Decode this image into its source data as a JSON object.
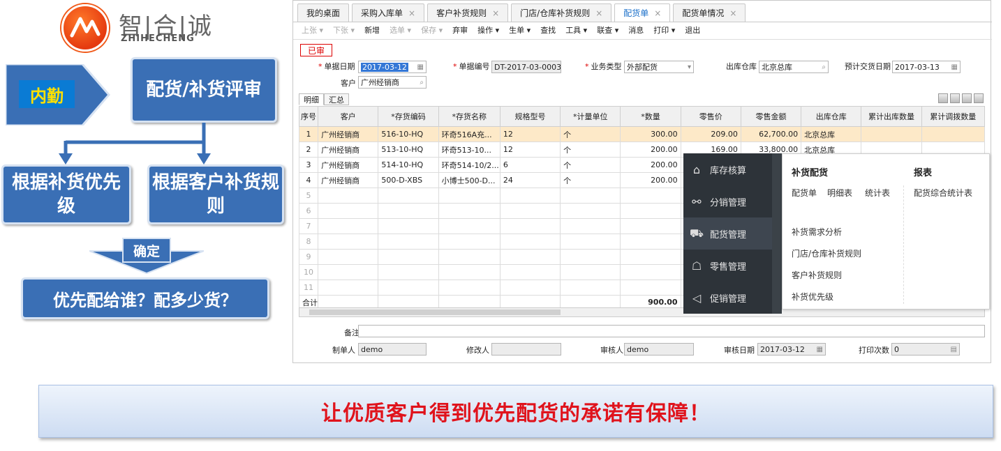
{
  "logo": {
    "name": "智|合|诚",
    "sub": "ZHIHECHENG"
  },
  "flow": {
    "inner": "内勤",
    "review": "配货/补货评审",
    "priority": "根据补货优先级",
    "rule": "根据客户补货规则",
    "confirm": "确定",
    "question": "优先配给谁？配多少货？"
  },
  "tabs": [
    {
      "label": "我的桌面",
      "closable": false
    },
    {
      "label": "采购入库单",
      "closable": true
    },
    {
      "label": "客户补货规则",
      "closable": true
    },
    {
      "label": "门店/仓库补货规则",
      "closable": true
    },
    {
      "label": "配货单",
      "closable": true,
      "active": true
    },
    {
      "label": "配货单情况",
      "closable": true
    }
  ],
  "toolbar": [
    {
      "label": "上张 ▾",
      "disabled": true
    },
    {
      "label": "下张 ▾",
      "disabled": true
    },
    {
      "label": "新增",
      "disabled": false
    },
    {
      "label": "选单 ▾",
      "disabled": true
    },
    {
      "label": "保存 ▾",
      "disabled": true
    },
    {
      "label": "弃审",
      "disabled": false
    },
    {
      "label": "操作 ▾",
      "disabled": false
    },
    {
      "label": "生单 ▾",
      "disabled": false
    },
    {
      "label": "查找",
      "disabled": false
    },
    {
      "label": "工具 ▾",
      "disabled": false
    },
    {
      "label": "联查 ▾",
      "disabled": false
    },
    {
      "label": "消息",
      "disabled": false
    },
    {
      "label": "打印 ▾",
      "disabled": false
    },
    {
      "label": "退出",
      "disabled": false
    }
  ],
  "status": "已审",
  "form": {
    "date_label": "单据日期",
    "date_value": "2017-03-12",
    "no_label": "单据编号",
    "no_value": "DT-2017-03-0003",
    "type_label": "业务类型",
    "type_value": "外部配货",
    "wh_label": "出库仓库",
    "wh_value": "北京总库",
    "eta_label": "预计交货日期",
    "eta_value": "2017-03-13",
    "cust_label": "客户",
    "cust_value": "广州经销商"
  },
  "subtabs": [
    "明细",
    "汇总"
  ],
  "grid": {
    "columns": [
      "序号",
      "客户",
      "*存货编码",
      "*存货名称",
      "规格型号",
      "*计量单位",
      "*数量",
      "零售价",
      "零售金额",
      "出库仓库",
      "累计出库数量",
      "累计调拨数量"
    ],
    "rows": [
      [
        "1",
        "广州经销商",
        "516-10-HQ",
        "环奇516A充...",
        "12",
        "个",
        "300.00",
        "209.00",
        "62,700.00",
        "北京总库",
        "",
        ""
      ],
      [
        "2",
        "广州经销商",
        "513-10-HQ",
        "环奇513-10...",
        "12",
        "个",
        "200.00",
        "169.00",
        "33,800.00",
        "北京总库",
        "",
        ""
      ],
      [
        "3",
        "广州经销商",
        "514-10-HQ",
        "环奇514-10/2...",
        "6",
        "个",
        "200.00",
        "",
        "",
        "",
        "",
        ""
      ],
      [
        "4",
        "广州经销商",
        "500-D-XBS",
        "小博士500-D...",
        "24",
        "个",
        "200.00",
        "",
        "",
        "",
        "",
        ""
      ]
    ],
    "empty_rows": [
      "5",
      "6",
      "7",
      "8",
      "9",
      "10",
      "11"
    ],
    "total_label": "合计",
    "total_qty": "900.00"
  },
  "footer": {
    "remark_label": "备注",
    "maker_label": "制单人",
    "maker_value": "demo",
    "modifier_label": "修改人",
    "modifier_value": "",
    "auditor_label": "审核人",
    "auditor_value": "demo",
    "audit_date_label": "审核日期",
    "audit_date_value": "2017-03-12",
    "print_label": "打印次数",
    "print_value": "0"
  },
  "menu": {
    "items": [
      {
        "label": "库存核算",
        "icon": "warehouse-icon",
        "glyph": "⌂"
      },
      {
        "label": "分销管理",
        "icon": "distribution-icon",
        "glyph": "⚯"
      },
      {
        "label": "配货管理",
        "icon": "truck-icon",
        "glyph": "⛟"
      },
      {
        "label": "零售管理",
        "icon": "retail-icon",
        "glyph": "☖"
      },
      {
        "label": "促销管理",
        "icon": "megaphone-icon",
        "glyph": "◁"
      }
    ],
    "panel": {
      "col1_title": "补货配货",
      "col1_links": [
        "配货单",
        "明细表",
        "统计表"
      ],
      "col1_more": [
        "补货需求分析",
        "门店/仓库补货规则",
        "客户补货规则",
        "补货优先级"
      ],
      "col2_title": "报表",
      "col2_links": [
        "配货综合统计表"
      ]
    }
  },
  "banner": "让优质客户得到优先配货的承诺有保障！",
  "colors": {
    "box_blue": "#3a6fb5",
    "banner_red": "#e0131c",
    "menu_dark": "#2d3339"
  }
}
